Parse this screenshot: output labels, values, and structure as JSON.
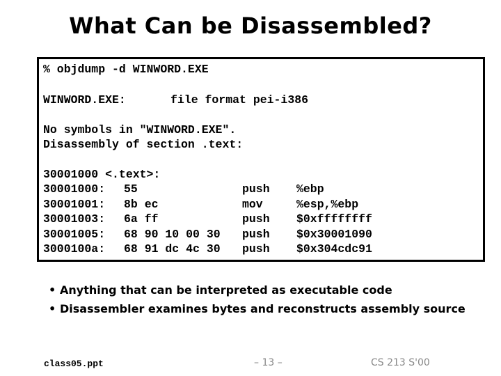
{
  "title": "What Can be Disassembled?",
  "code": {
    "command": "% objdump -d WINWORD.EXE",
    "file_label": "WINWORD.EXE:",
    "file_format": "file format pei-i386",
    "no_symbols": "No symbols in \"WINWORD.EXE\".",
    "section": "Disassembly of section .text:",
    "label_line": "30001000 <.text>:",
    "rows": [
      {
        "addr": "30001000:",
        "bytes": "55",
        "op": "push",
        "args": "%ebp"
      },
      {
        "addr": "30001001:",
        "bytes": "8b ec",
        "op": "mov",
        "args": "%esp,%ebp"
      },
      {
        "addr": "30001003:",
        "bytes": "6a ff",
        "op": "push",
        "args": "$0xffffffff"
      },
      {
        "addr": "30001005:",
        "bytes": "68 90 10 00 30",
        "op": "push",
        "args": "$0x30001090"
      },
      {
        "addr": "3000100a:",
        "bytes": "68 91 dc 4c 30",
        "op": "push",
        "args": "$0x304cdc91"
      }
    ]
  },
  "bullets": [
    "Anything that can be interpreted as executable code",
    "Disassembler examines bytes and reconstructs assembly source"
  ],
  "bullet_glyph": "•",
  "footer": {
    "file": "class05.ppt",
    "page": "– 13 –",
    "course": "CS 213 S'00"
  }
}
